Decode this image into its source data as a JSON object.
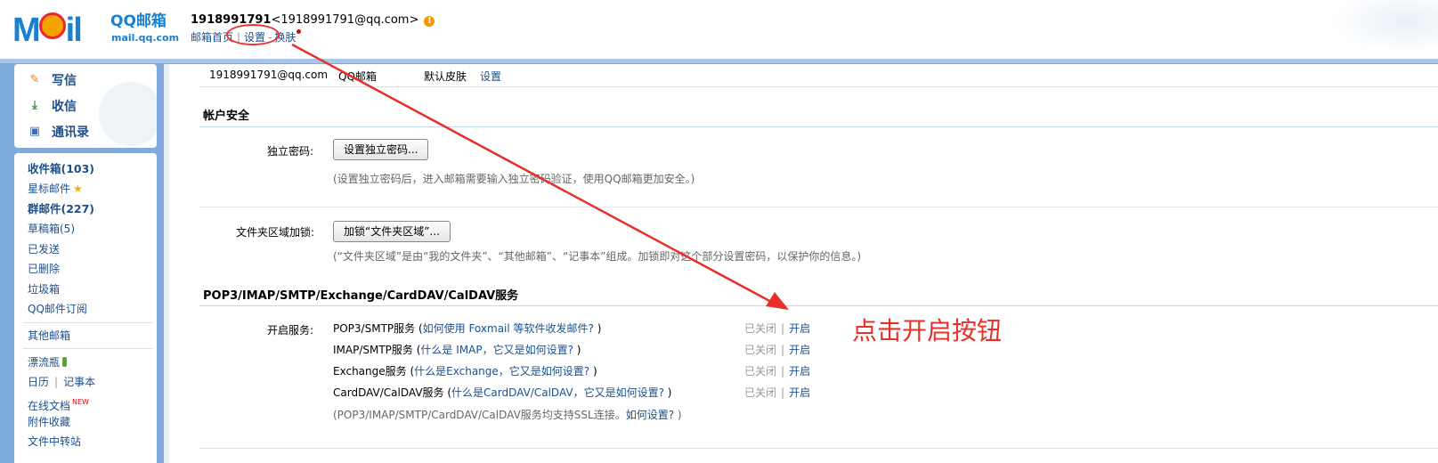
{
  "header": {
    "logo_text": "MOil",
    "logo_brand": "QQ邮箱",
    "logo_domain": "mail.qq.com",
    "account_name": "1918991791",
    "account_email": "<1918991791@qq.com>",
    "warn_icon": "!",
    "links": {
      "home": "邮箱首页",
      "separator": "|",
      "settings": "设置",
      "dash": "-",
      "skin": "换肤"
    }
  },
  "sidebar": {
    "primary": [
      {
        "label": "写信",
        "icon": "write-icon"
      },
      {
        "label": "收信",
        "icon": "inbox-download-icon"
      },
      {
        "label": "通讯录",
        "icon": "contacts-icon"
      }
    ],
    "folders": {
      "inbox": "收件箱(103)",
      "starred": "星标邮件",
      "group": "群邮件(227)",
      "drafts": "草稿箱(5)",
      "sent": "已发送",
      "deleted": "已删除",
      "spam": "垃圾箱",
      "subscriptions": "QQ邮件订阅",
      "other": "其他邮箱",
      "drift_bottle": "漂流瓶",
      "calendar": "日历",
      "calendar_sep": "|",
      "notes": "记事本",
      "online_docs": "在线文档",
      "new_tag": "NEW",
      "attachments": "附件收藏",
      "transfer": "文件中转站"
    }
  },
  "subnav": {
    "email": "1918991791@qq.com",
    "brand": "QQ邮箱",
    "skin": "默认皮肤",
    "settings": "设置"
  },
  "security": {
    "title": "帐户安全",
    "independent_pw_label": "独立密码:",
    "independent_pw_button": "设置独立密码...",
    "independent_pw_hint": "(设置独立密码后，进入邮箱需要输入独立密码验证，使用QQ邮箱更加安全。)",
    "folder_lock_label": "文件夹区域加锁:",
    "folder_lock_button": "加锁“文件夹区域”...",
    "folder_lock_hint": "(“文件夹区域”是由“我的文件夹”、“其他邮箱”、“记事本”组成。加锁即对这个部分设置密码，以保护你的信息。)"
  },
  "services": {
    "title": "POP3/IMAP/SMTP/Exchange/CardDAV/CalDAV服务",
    "enable_label": "开启服务:",
    "rows": [
      {
        "name": "POP3/SMTP服务 (",
        "link": "如何使用 Foxmail 等软件收发邮件?",
        "close": " )",
        "state": "已关闭",
        "sep": "|",
        "action": "开启"
      },
      {
        "name": "IMAP/SMTP服务 (",
        "link": "什么是 IMAP，它又是如何设置?",
        "close": " )",
        "state": "已关闭",
        "sep": "|",
        "action": "开启"
      },
      {
        "name": "Exchange服务 (",
        "link": "什么是Exchange，它又是如何设置?",
        "close": " )",
        "state": "已关闭",
        "sep": "|",
        "action": "开启"
      },
      {
        "name": "CardDAV/CalDAV服务 (",
        "link": "什么是CardDAV/CalDAV，它又是如何设置?",
        "close": " )",
        "state": "已关闭",
        "sep": "|",
        "action": "开启"
      }
    ],
    "ssl_hint_prefix": "(POP3/IMAP/SMTP/CardDAV/CalDAV服务均支持SSL连接。",
    "ssl_hint_link": "如何设置?",
    "ssl_hint_suffix": " )"
  },
  "annotation": {
    "text": "点击开启按钮",
    "color": "#e8302a"
  },
  "colors": {
    "link": "#1e4f8c",
    "frame": "#7faadc",
    "rule": "#c5d7ec"
  }
}
